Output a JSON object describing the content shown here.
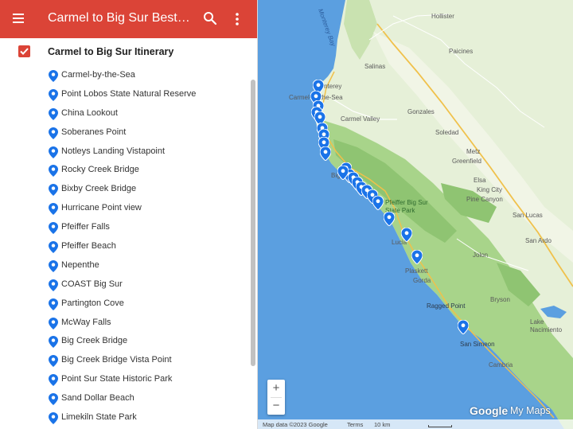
{
  "header": {
    "title": "Carmel to Big Sur Best St...",
    "menu_icon": "hamburger-menu-icon",
    "search_icon": "search-icon",
    "more_icon": "more-vert-icon",
    "background_color": "#db4437"
  },
  "layer": {
    "title": "Carmel to Big Sur Itinerary",
    "checked": true,
    "checkbox_color": "#db4437"
  },
  "places": [
    "Carmel-by-the-Sea",
    "Point Lobos State Natural Reserve",
    "China Lookout",
    "Soberanes Point",
    "Notleys Landing Vistapoint",
    "Rocky Creek Bridge",
    "Bixby Creek Bridge",
    "Hurricane Point view",
    "Pfeiffer Falls",
    "Pfeiffer Beach",
    "Nepenthe",
    "COAST Big Sur",
    "Partington Cove",
    "McWay Falls",
    "Big Creek Bridge",
    "Big Creek Bridge Vista Point",
    "Point Sur State Historic Park",
    "Sand Dollar Beach",
    "Limekiln State Park"
  ],
  "place_icon": "location-pin-icon",
  "pin_color": "#1a73e8",
  "map": {
    "labels": {
      "monterey_bay": "Monterey Bay",
      "salinas": "Salinas",
      "hollister": "Hollister",
      "paicines": "Paicines",
      "monterey": "Monterey",
      "carmel": "Carmel-by-the-Sea",
      "carmel_valley": "Carmel Valley",
      "gonzales": "Gonzales",
      "soledad": "Soledad",
      "metz": "Metz",
      "greenfield": "Greenfield",
      "elsa": "Elsa",
      "king_city": "King City",
      "pine_canyon": "Pine Canyon",
      "pfeiffer_park": "Pfeiffer Big Sur State Park",
      "san_lucas": "San Lucas",
      "lucia": "Lucia",
      "san_ardo": "San Ardo",
      "jolon": "Jolon",
      "plaskett": "Plaskett",
      "gorda": "Gorda",
      "ragged_point": "Ragged Point",
      "bryson": "Bryson",
      "lake_nacimiento": "Lake Nacimiento",
      "san_simeon": "San Simeon",
      "cambria": "Cambria",
      "big_sur": "Big Sur"
    },
    "zoom_in": "+",
    "zoom_out": "−",
    "attribution": {
      "map_data": "Map data ©2023 Google",
      "terms": "Terms",
      "scale": "10 km"
    },
    "logo_google": "Google",
    "logo_mymaps": "My Maps"
  }
}
